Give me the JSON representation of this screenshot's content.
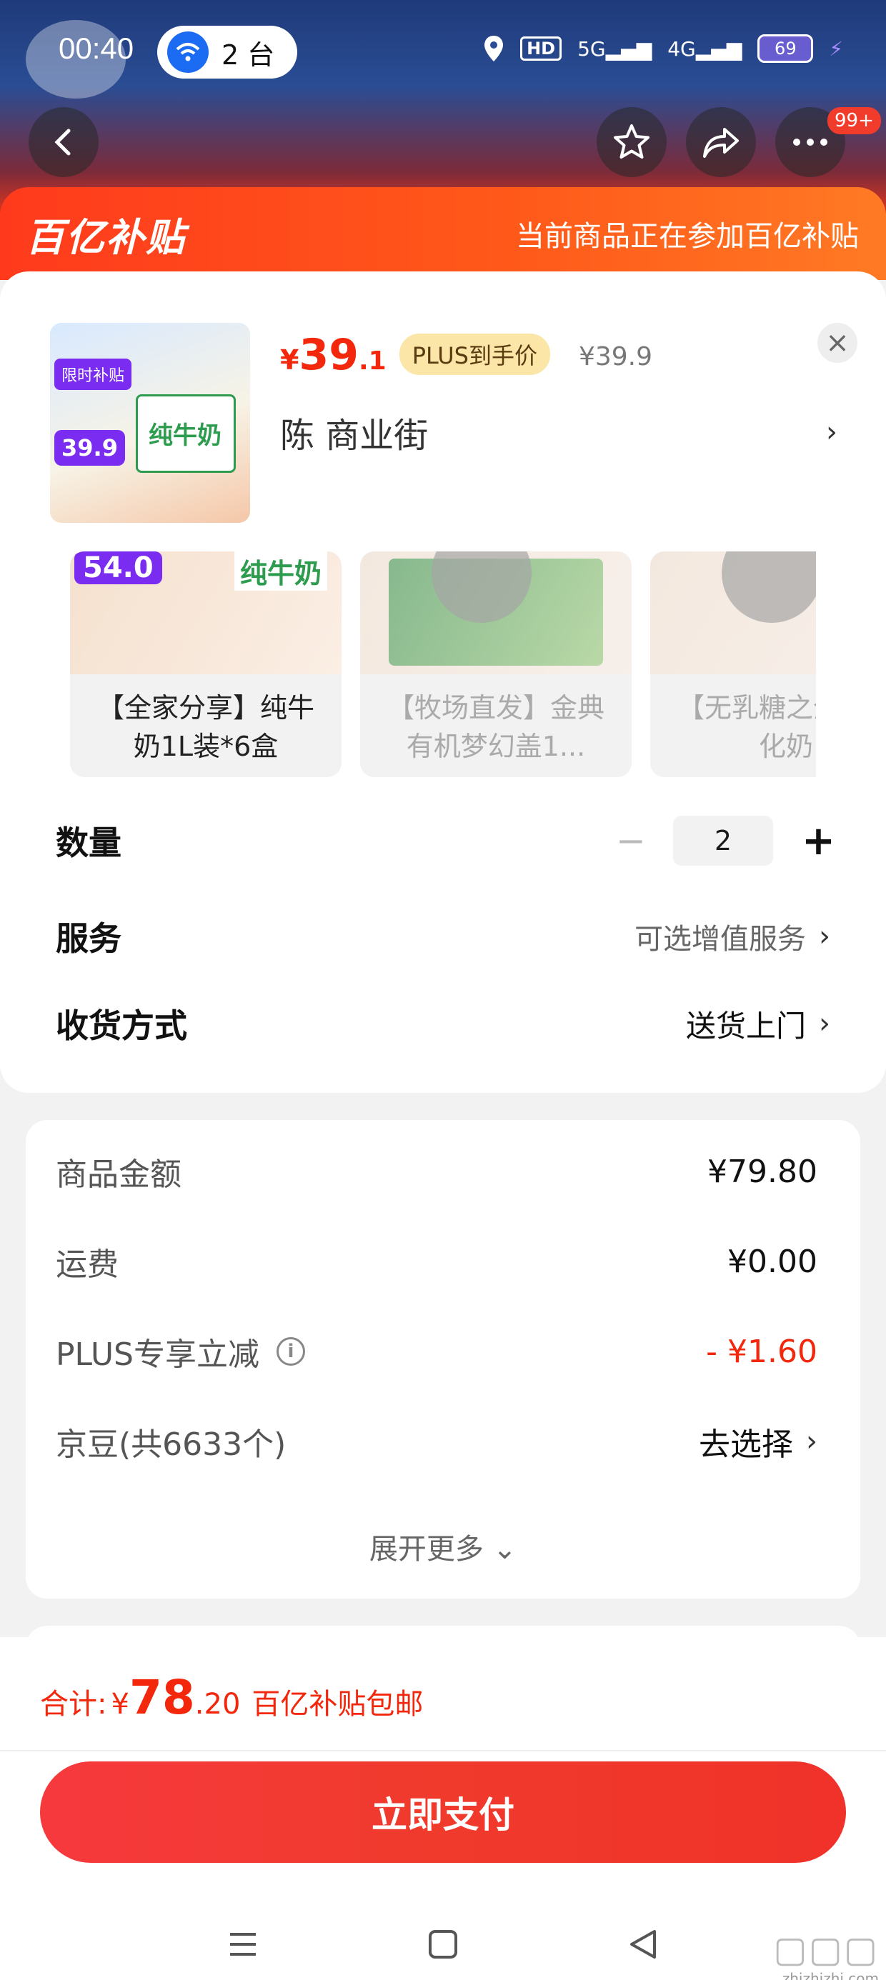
{
  "status_bar": {
    "time": "00:40",
    "cast_label": "2 台",
    "network_hd": "HD",
    "net_5g": "5G",
    "net_4g": "4G",
    "battery": "69"
  },
  "header": {
    "more_badge": "99+",
    "back_icon": "back-icon",
    "favorite_icon": "star-icon",
    "share_icon": "share-icon",
    "more_icon": "more-icon"
  },
  "subsidy": {
    "logo": "百亿补贴",
    "note": "当前商品正在参加百亿补贴"
  },
  "product": {
    "price_yen": "¥",
    "price_int": "39",
    "price_dec": ".1",
    "plus_tag": "PLUS到手价",
    "original_price": "¥39.9",
    "address": "陈  商业街",
    "thumb_tag": "限时补贴",
    "thumb_price": "39.9",
    "thumb_label": "纯牛奶"
  },
  "variants": [
    {
      "label": "【全家分享】纯牛奶1L装*6盒",
      "price": "54.0",
      "milk": "纯牛奶"
    },
    {
      "label": "【牧场直发】金典有机梦幻盖1..."
    },
    {
      "label": "【无乳糖之全脂舒化奶"
    }
  ],
  "options": {
    "quantity_label": "数量",
    "quantity_value": "2",
    "minus": "−",
    "plus": "+",
    "service_label": "服务",
    "service_value": "可选增值服务",
    "delivery_label": "收货方式",
    "delivery_value": "送货上门"
  },
  "price_detail": {
    "goods_label": "商品金额",
    "goods_value": "¥79.80",
    "shipping_label": "运费",
    "shipping_value": "¥0.00",
    "plus_label": "PLUS专享立减",
    "plus_value": "- ¥1.60",
    "jingdou_label": "京豆(共6633个)",
    "jingdou_value": "去选择",
    "expand_label": "展开更多"
  },
  "footer": {
    "total_label": "合计:",
    "total_yen": "¥",
    "total_int": "78",
    "total_dec": ".20",
    "total_note": "百亿补贴包邮",
    "pay_label": "立即支付"
  },
  "watermark": {
    "site": "zhizhizhi.com"
  },
  "colors": {
    "accent_red": "#f2270c",
    "plus_gold": "#fbe6a8",
    "subsidy_orange": "#ff5a1a"
  }
}
